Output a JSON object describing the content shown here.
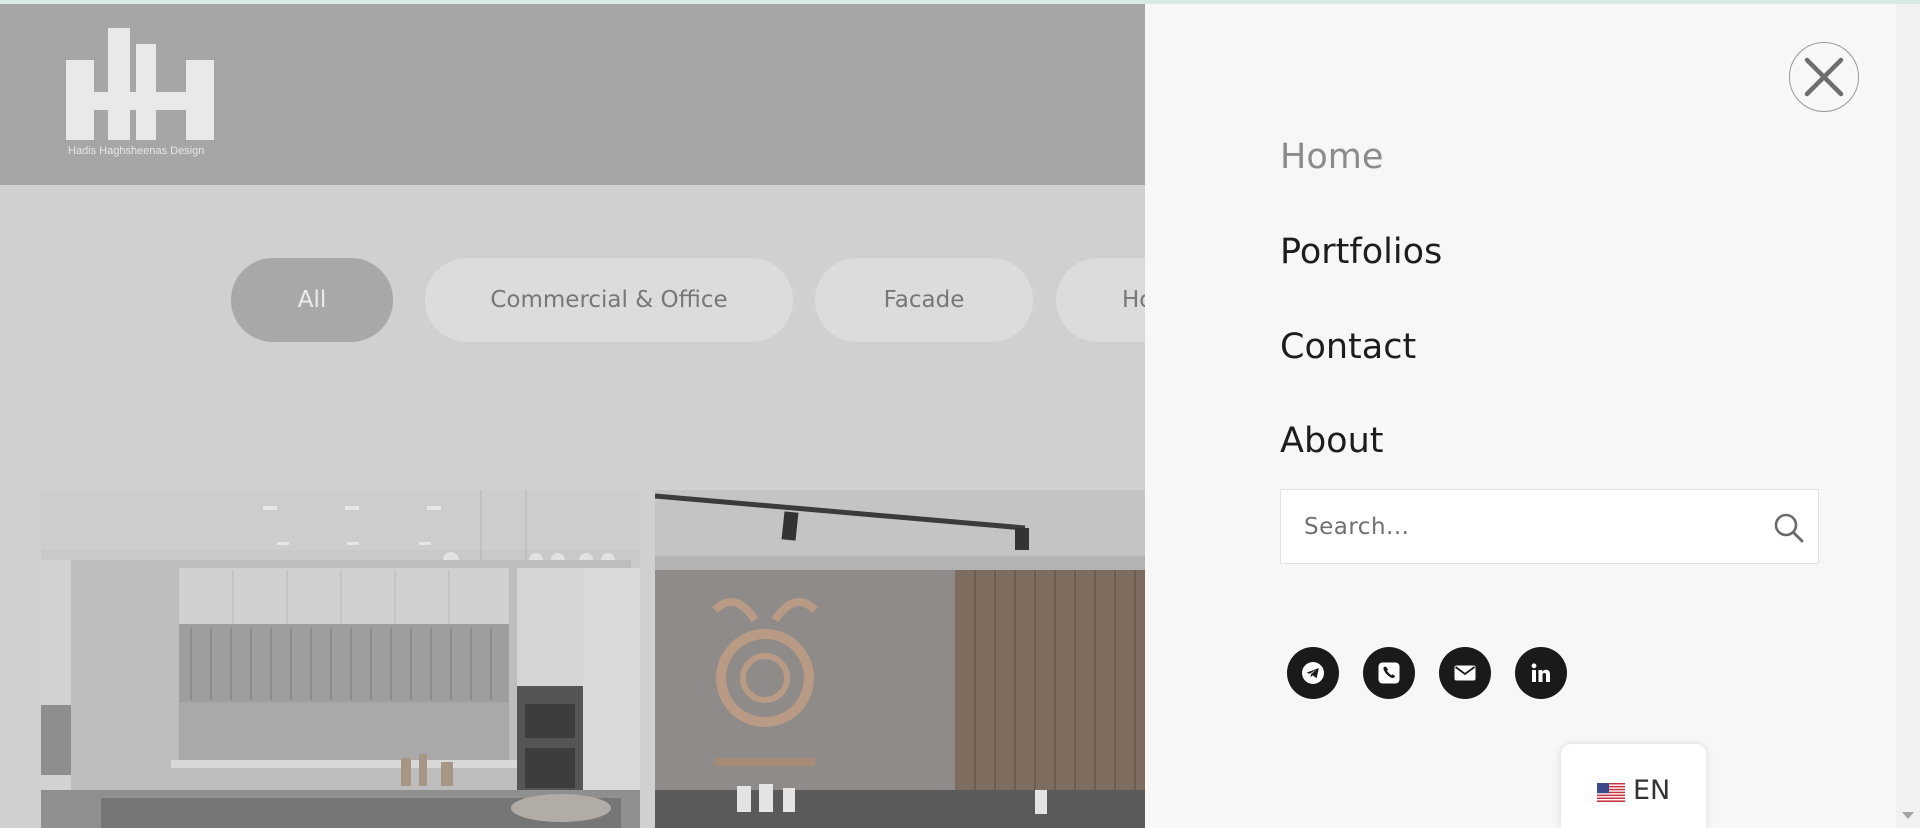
{
  "header": {
    "logo_text": "Hadis Haghsheenas Design"
  },
  "filters": [
    {
      "label": "All"
    },
    {
      "label": "Commercial & Office"
    },
    {
      "label": "Facade"
    },
    {
      "label": "Ho"
    }
  ],
  "menu": {
    "items": [
      {
        "label": "Home"
      },
      {
        "label": "Portfolios"
      },
      {
        "label": "Contact"
      },
      {
        "label": "About"
      }
    ],
    "search": {
      "placeholder": "Search..."
    },
    "social": [
      "telegram-icon",
      "phone-icon",
      "email-icon",
      "linkedin-icon"
    ]
  },
  "language": {
    "code": "EN"
  },
  "colors": {
    "overlay_panel": "#f7f7f7",
    "nav_text": "#1d1d1d",
    "nav_current": "#8b8b8b",
    "social_bg": "#1a1a1a",
    "active_filter": "#a8a8a8"
  }
}
